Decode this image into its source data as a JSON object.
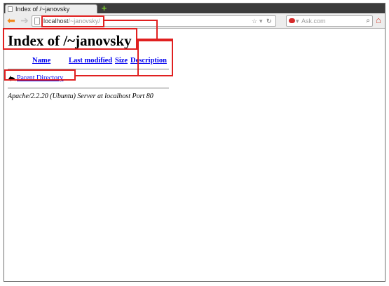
{
  "browser": {
    "tab_title": "Index of /~janovsky",
    "new_tab_label": "+",
    "url_host": "localhost",
    "url_path": "/~janovsky/",
    "search_placeholder": "Ask.com"
  },
  "page": {
    "title": "Index of /~janovsky",
    "columns": [
      "Name",
      "Last modified",
      "Size",
      "Description"
    ],
    "rows": [
      {
        "name": "Parent Directory",
        "icon": "back-arrow-icon"
      }
    ],
    "address": "Apache/2.2.20 (Ubuntu) Server at localhost Port 80"
  },
  "colors": {
    "highlight": "#e02020",
    "link": "#0000ee",
    "tabbar": "#3c3c3c"
  }
}
